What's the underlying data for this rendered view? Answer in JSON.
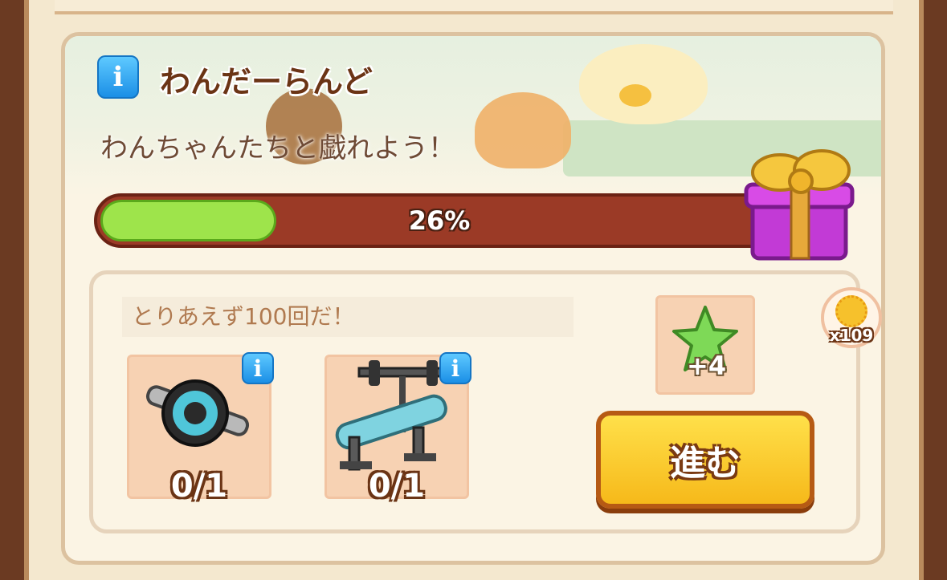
{
  "event": {
    "title": "わんだーらんど",
    "subtitle": "わんちゃんたちと戯れよう！",
    "progress_label": "26%",
    "progress_fraction": 0.26
  },
  "mission": {
    "text": "とりあえず100回だ！",
    "items": [
      {
        "icon": "ab-roller-icon",
        "count": "0/1"
      },
      {
        "icon": "bench-press-icon",
        "count": "0/1"
      }
    ],
    "reward": {
      "icon": "green-star-icon",
      "amount": "+4"
    },
    "go_button": "進む"
  },
  "currency": {
    "icon": "sun-coin-icon",
    "count": "x109"
  },
  "colors": {
    "progress_fill": "#9ee44b",
    "progress_track": "#9b3a26",
    "button": "#f6b91a",
    "info_icon": "#1b8fe6"
  }
}
